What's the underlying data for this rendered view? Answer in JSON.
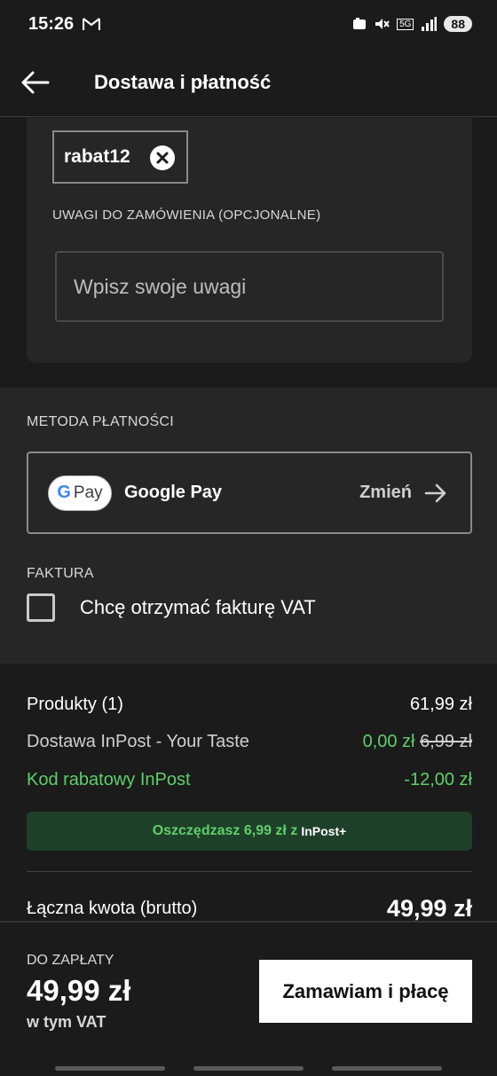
{
  "status_bar": {
    "time": "15:26",
    "mail_icon": "gmail-icon",
    "network": "5G",
    "battery": "88"
  },
  "app_bar": {
    "title": "Dostawa i płatność",
    "back_icon": "arrow-left-icon"
  },
  "discount": {
    "code": "rabat12",
    "remove_icon": "close-circle-icon"
  },
  "notes": {
    "label": "UWAGI DO ZAMÓWIENIA (OPCJONALNE)",
    "placeholder": "Wpisz swoje uwagi",
    "value": ""
  },
  "payment": {
    "section_label": "METODA PŁATNOŚCI",
    "badge_g": "G",
    "badge_pay": "Pay",
    "method_name": "Google Pay",
    "change_label": "Zmień"
  },
  "invoice": {
    "section_label": "FAKTURA",
    "checkbox_label": "Chcę otrzymać fakturę VAT",
    "checked": false
  },
  "summary": {
    "products_label": "Produkty (1)",
    "products_value": "61,99 zł",
    "delivery_label": "Dostawa InPost - Your Taste",
    "delivery_value": "0,00 zł",
    "delivery_old_value": "6,99 zł",
    "discount_label": "Kod rabatowy InPost",
    "discount_value": "-12,00 zł",
    "savings_text": "Oszczędzasz 6,99 zł z",
    "savings_brand": "InPost+",
    "total_label": "Łączna kwota (brutto)",
    "total_value": "49,99 zł"
  },
  "checkout": {
    "due_label": "DO ZAPŁATY",
    "due_amount": "49,99 zł",
    "vat_note": "w tym VAT",
    "order_button": "Zamawiam i płacę"
  },
  "colors": {
    "background": "#1b1b1b",
    "card": "#262626",
    "accent_green": "#5ecf6c",
    "banner_green": "#1f4028"
  }
}
